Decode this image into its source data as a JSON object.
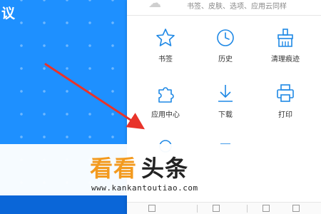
{
  "background": {
    "title_fragment": "议",
    "accent_color": "#1e90ff"
  },
  "menu": {
    "header_text": "书签、皮肤、选项、应用云同样",
    "header_icon": "cloud-icon",
    "items": [
      {
        "label": "书签",
        "icon": "star-icon"
      },
      {
        "label": "历史",
        "icon": "clock-icon"
      },
      {
        "label": "清理痕迹",
        "icon": "broom-icon"
      },
      {
        "label": "应用中心",
        "icon": "puzzle-icon"
      },
      {
        "label": "下载",
        "icon": "download-icon"
      },
      {
        "label": "打印",
        "icon": "printer-icon"
      }
    ]
  },
  "annotation": {
    "arrow_color": "#e8332a"
  },
  "watermark": {
    "brand_part1": "看看",
    "brand_part2": "头条",
    "url": "www.kankantoutiao.com",
    "brand_color": "#f39a1e"
  }
}
